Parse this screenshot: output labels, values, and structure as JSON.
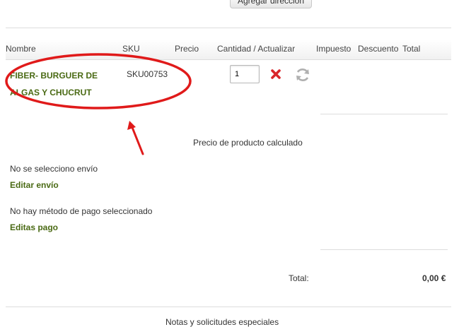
{
  "top": {
    "add_address_button": "Agregar dirección"
  },
  "table": {
    "columns": {
      "name": "Nombre",
      "sku": "SKU",
      "price": "Precio",
      "quantity": "Cantidad / Actualizar",
      "tax": "Impuesto",
      "discount": "Descuento",
      "total": "Total"
    },
    "rows": [
      {
        "name_line1": "FIBER- BURGUER DE",
        "name_line2": "ALGAS Y CHUCRUT",
        "sku": "SKU00753",
        "quantity": "1"
      }
    ]
  },
  "summary": {
    "price_calculated": "Precio de producto calculado",
    "no_shipping": "No se selecciono envío",
    "edit_shipping": "Editar envío",
    "no_payment": "No hay método de pago seleccionado",
    "edit_payment": "Editas pago",
    "total_label": "Total:",
    "total_value": "0,00 €"
  },
  "footer": {
    "notes_heading": "Notas y solicitudes especiales"
  },
  "colors": {
    "link_green": "#4a6a14",
    "remove_red": "#d9262a",
    "annotation_red": "#e01a1a",
    "border_gray": "#dddddd"
  },
  "icons": {
    "remove": "remove-x-icon",
    "refresh": "refresh-icon"
  }
}
